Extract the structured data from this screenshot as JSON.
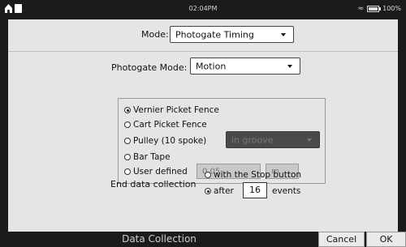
{
  "status_bar": {
    "time": "02:04PM",
    "battery": "100%"
  },
  "mode": {
    "label": "Mode:",
    "value": "Photogate Timing"
  },
  "photogate_mode": {
    "label": "Photogate Mode:",
    "value": "Motion"
  },
  "options": [
    {
      "label": "Vernier Picket Fence",
      "selected": true
    },
    {
      "label": "Cart Picket Fence",
      "selected": false
    },
    {
      "label": "Pulley (10 spoke)",
      "selected": false
    },
    {
      "label": "Bar Tape",
      "selected": false
    },
    {
      "label": "User defined",
      "selected": false
    }
  ],
  "pulley_select": {
    "value": "in groove"
  },
  "user_defined": {
    "value": "0.05",
    "unit": "m"
  },
  "end_collection": {
    "label": "End data collection",
    "stop_option": "with the Stop button",
    "after_option": "after",
    "events_value": "16",
    "events_label": "events"
  },
  "bottom": {
    "title": "Data Collection",
    "cancel": "Cancel",
    "ok": "OK"
  }
}
